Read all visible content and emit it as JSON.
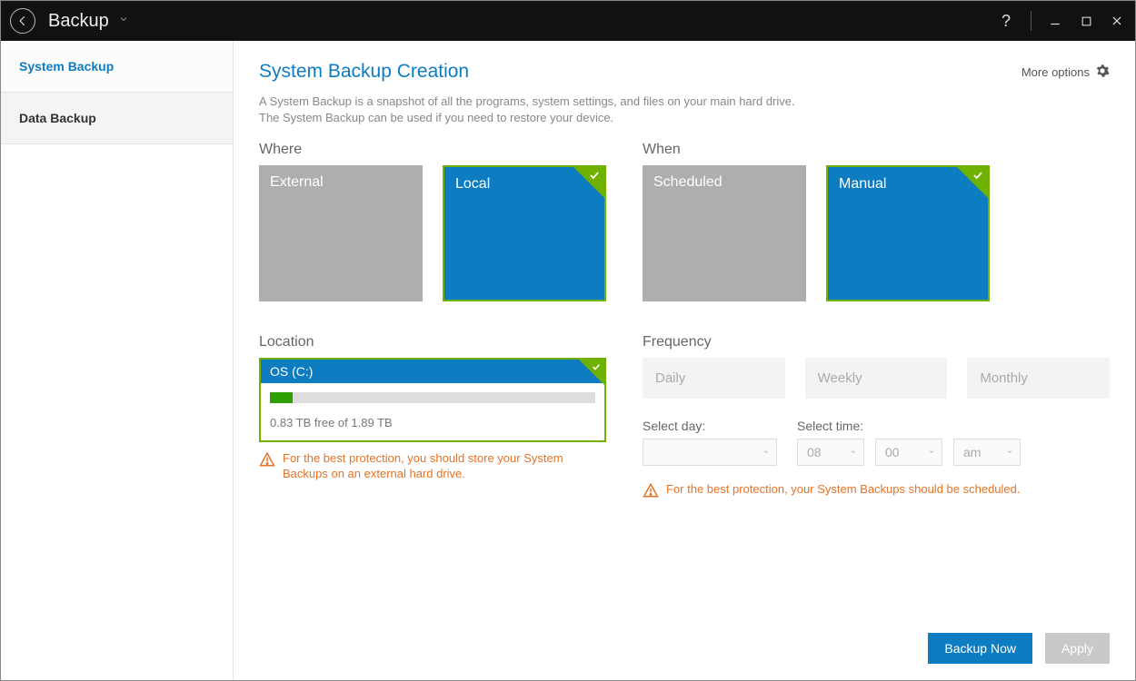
{
  "titlebar": {
    "app_title": "Backup"
  },
  "sidebar": {
    "items": [
      "System Backup",
      "Data Backup"
    ],
    "active_index": 0
  },
  "header": {
    "title": "System Backup Creation",
    "more_options_label": "More options"
  },
  "description": {
    "line1": "A System Backup is a snapshot of all the programs, system settings, and files on your main hard drive.",
    "line2": "The System Backup can be used if you need to restore your device."
  },
  "where": {
    "label": "Where",
    "options": [
      "External",
      "Local"
    ],
    "selected_index": 1
  },
  "when": {
    "label": "When",
    "options": [
      "Scheduled",
      "Manual"
    ],
    "selected_index": 1
  },
  "location": {
    "label": "Location",
    "drive_name": "OS (C:)",
    "free_text": "0.83 TB free of 1.89 TB",
    "used_pct": 7
  },
  "location_warning": "For the best protection, you should store your System Backups on an external hard drive.",
  "frequency": {
    "label": "Frequency",
    "options": [
      "Daily",
      "Weekly",
      "Monthly"
    ]
  },
  "select_day": {
    "label": "Select day:",
    "value": ""
  },
  "select_time": {
    "label": "Select time:",
    "hour": "08",
    "minute": "00",
    "ampm": "am"
  },
  "schedule_warning": "For the best protection, your System Backups should be scheduled.",
  "footer": {
    "primary": "Backup Now",
    "secondary": "Apply"
  },
  "colors": {
    "accent_blue": "#0d7cc1",
    "accent_green": "#6eb100",
    "warning_orange": "#e57325"
  }
}
